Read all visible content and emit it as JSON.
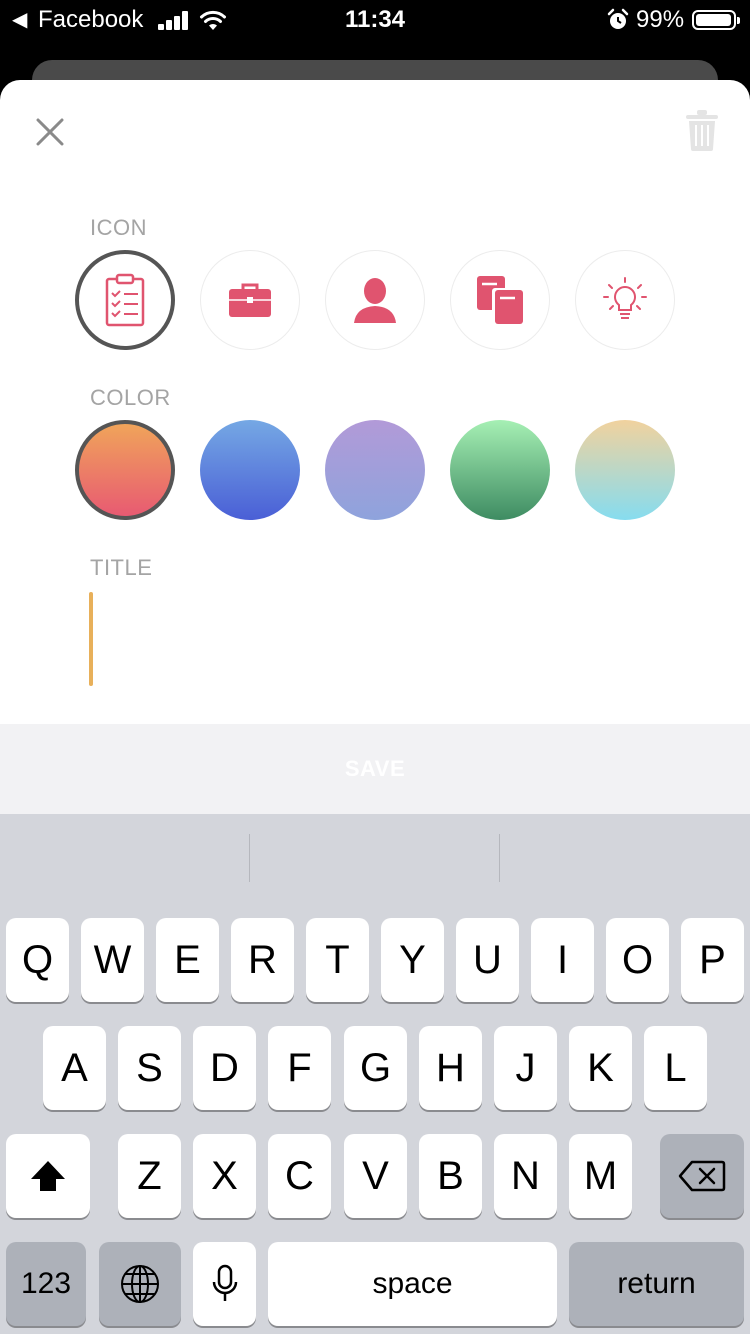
{
  "status_bar": {
    "back_arrow": "◀",
    "back_app": "Facebook",
    "time": "11:34",
    "battery_percent": "99%",
    "icons": [
      "signal-icon",
      "wifi-icon",
      "alarm-icon",
      "battery-icon"
    ]
  },
  "header": {
    "close_icon": "close-icon",
    "delete_icon": "trash-icon"
  },
  "icon_section": {
    "label": "ICON",
    "options": [
      {
        "icon": "clipboard-checklist-icon",
        "selected": true
      },
      {
        "icon": "briefcase-icon",
        "selected": false
      },
      {
        "icon": "person-icon",
        "selected": false
      },
      {
        "icon": "books-icon",
        "selected": false
      },
      {
        "icon": "lightbulb-icon",
        "selected": false
      }
    ],
    "icon_color": "#e0546f"
  },
  "color_section": {
    "label": "COLOR",
    "options": [
      {
        "name": "sunset",
        "from": "#f0a45a",
        "to": "#e85a72",
        "selected": true
      },
      {
        "name": "ocean",
        "from": "#75a8e4",
        "to": "#4a5fd6",
        "selected": false
      },
      {
        "name": "lavender",
        "from": "#b29ad8",
        "to": "#8ea3dc",
        "selected": false
      },
      {
        "name": "mint",
        "from": "#a6f0b4",
        "to": "#3e8c62",
        "selected": false
      },
      {
        "name": "peach-sky",
        "from": "#f1d29e",
        "to": "#86dcef",
        "selected": false
      }
    ]
  },
  "title_section": {
    "label": "TITLE",
    "value": "",
    "cursor_color": "#e8b05a"
  },
  "save_button": {
    "label": "SAVE"
  },
  "keyboard": {
    "row1": [
      "Q",
      "W",
      "E",
      "R",
      "T",
      "Y",
      "U",
      "I",
      "O",
      "P"
    ],
    "row2": [
      "A",
      "S",
      "D",
      "F",
      "G",
      "H",
      "J",
      "K",
      "L"
    ],
    "row3": [
      "Z",
      "X",
      "C",
      "V",
      "B",
      "N",
      "M"
    ],
    "numbers_key": "123",
    "space_key": "space",
    "return_key": "return",
    "shift_icon": "shift-icon",
    "delete_icon": "backspace-icon",
    "globe_icon": "globe-icon",
    "mic_icon": "microphone-icon"
  }
}
